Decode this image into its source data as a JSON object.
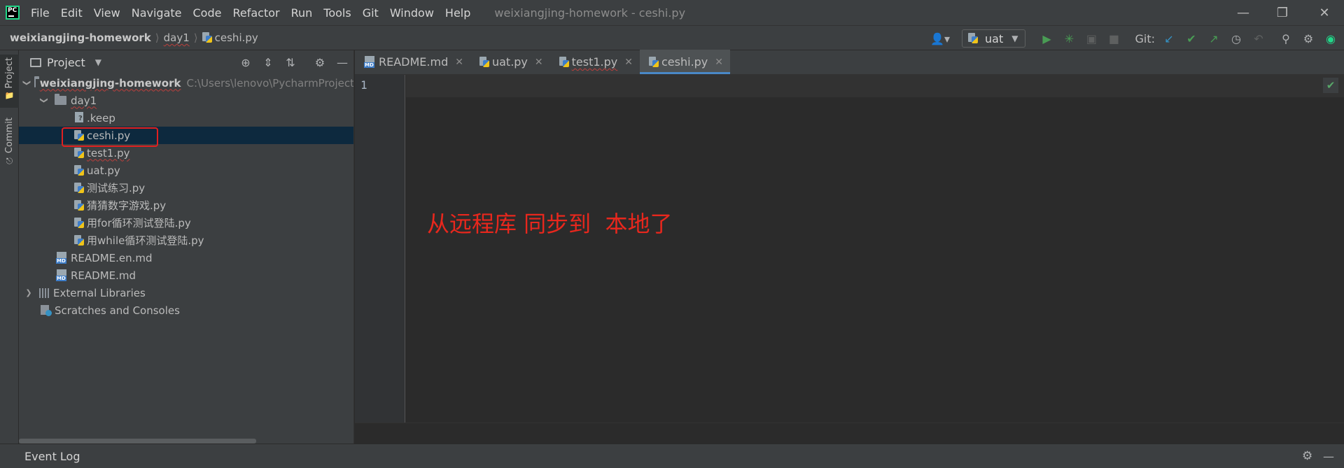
{
  "menu": {
    "items": [
      "File",
      "Edit",
      "View",
      "Navigate",
      "Code",
      "Refactor",
      "Run",
      "Tools",
      "Git",
      "Window",
      "Help"
    ],
    "window_title": "weixiangjing-homework - ceshi.py"
  },
  "breadcrumb": [
    "weixiangjing-homework",
    "day1",
    "ceshi.py"
  ],
  "toolbar": {
    "run_config": "uat",
    "git_label": "Git:"
  },
  "left_strip": {
    "project_tab": "Project",
    "commit_tab": "Commit"
  },
  "project_panel": {
    "title": "Project",
    "root": {
      "name": "weixiangjing-homework",
      "path": "C:\\Users\\lenovo\\PycharmProject"
    },
    "tree": [
      {
        "label": "day1"
      },
      {
        "label": ".keep"
      },
      {
        "label": "ceshi.py"
      },
      {
        "label": "test1.py"
      },
      {
        "label": "uat.py"
      },
      {
        "label": "测试练习.py"
      },
      {
        "label": "猜猜数字游戏.py"
      },
      {
        "label": "用for循环测试登陆.py"
      },
      {
        "label": "用while循环测试登陆.py"
      },
      {
        "label": "README.en.md"
      },
      {
        "label": "README.md"
      },
      {
        "label": "External Libraries"
      },
      {
        "label": "Scratches and Consoles"
      }
    ]
  },
  "editor": {
    "tabs": [
      {
        "label": "README.md"
      },
      {
        "label": "uat.py"
      },
      {
        "label": "test1.py"
      },
      {
        "label": "ceshi.py"
      }
    ],
    "active_tab": "ceshi.py",
    "line_number": "1",
    "annotation": "从远程库 同步到  本地了"
  },
  "bottom": {
    "event_log": "Event Log"
  },
  "colors": {
    "accent": "#4a88c7",
    "annotation": "#e8271d",
    "selection": "#0d293e",
    "run_green": "#499c54"
  }
}
